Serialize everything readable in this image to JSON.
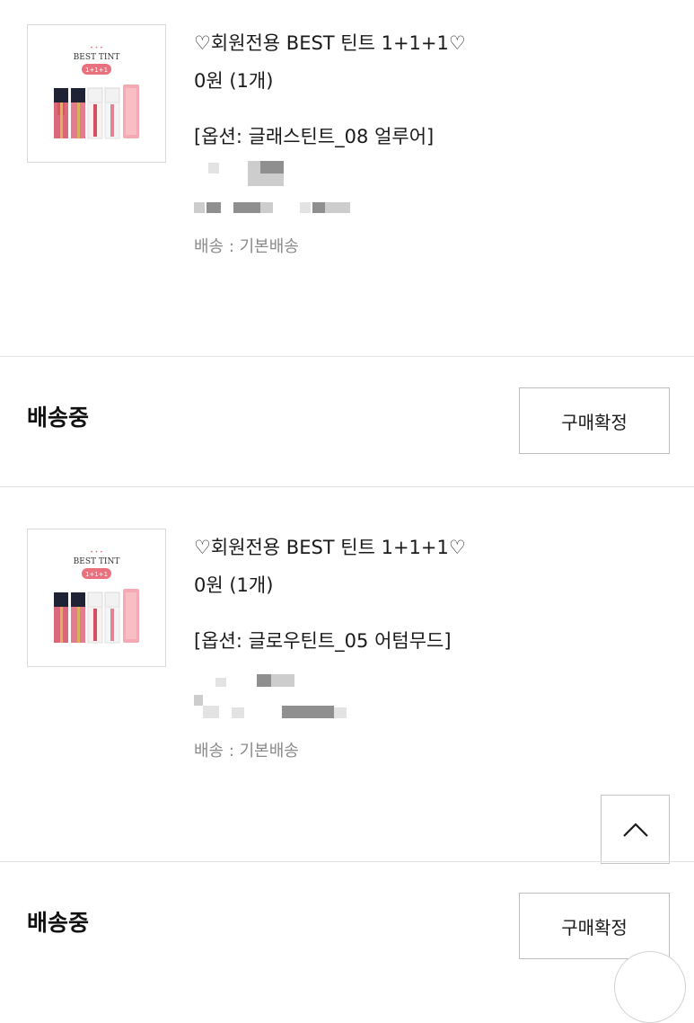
{
  "orders": [
    {
      "title": "♡회원전용 BEST 틴트 1+1+1♡",
      "price": "0원 (1개)",
      "option": "[옵션: 글래스틴트_08 얼루어]",
      "delivery": "배송 : 기본배송",
      "thumbnail": {
        "brand_dots": "• • •",
        "headline": "BEST TINT",
        "badge": "1+1+1"
      }
    },
    {
      "title": "♡회원전용 BEST 틴트 1+1+1♡",
      "price": "0원 (1개)",
      "option": "[옵션: 글로우틴트_05 어텀무드]",
      "delivery": "배송 : 기본배송",
      "thumbnail": {
        "brand_dots": "• • •",
        "headline": "BEST TINT",
        "badge": "1+1+1"
      }
    }
  ],
  "status_rows": [
    {
      "status": "배송중",
      "button_label": "구매확정"
    },
    {
      "status": "배송중",
      "button_label": "구매확정"
    }
  ],
  "scroll_top": {
    "icon": "chevron-up-icon"
  },
  "colors": {
    "badge": "#e9707d",
    "divider": "#e2e2e2",
    "muted_text": "#8a8a8a",
    "button_border": "#bdbdbd"
  }
}
